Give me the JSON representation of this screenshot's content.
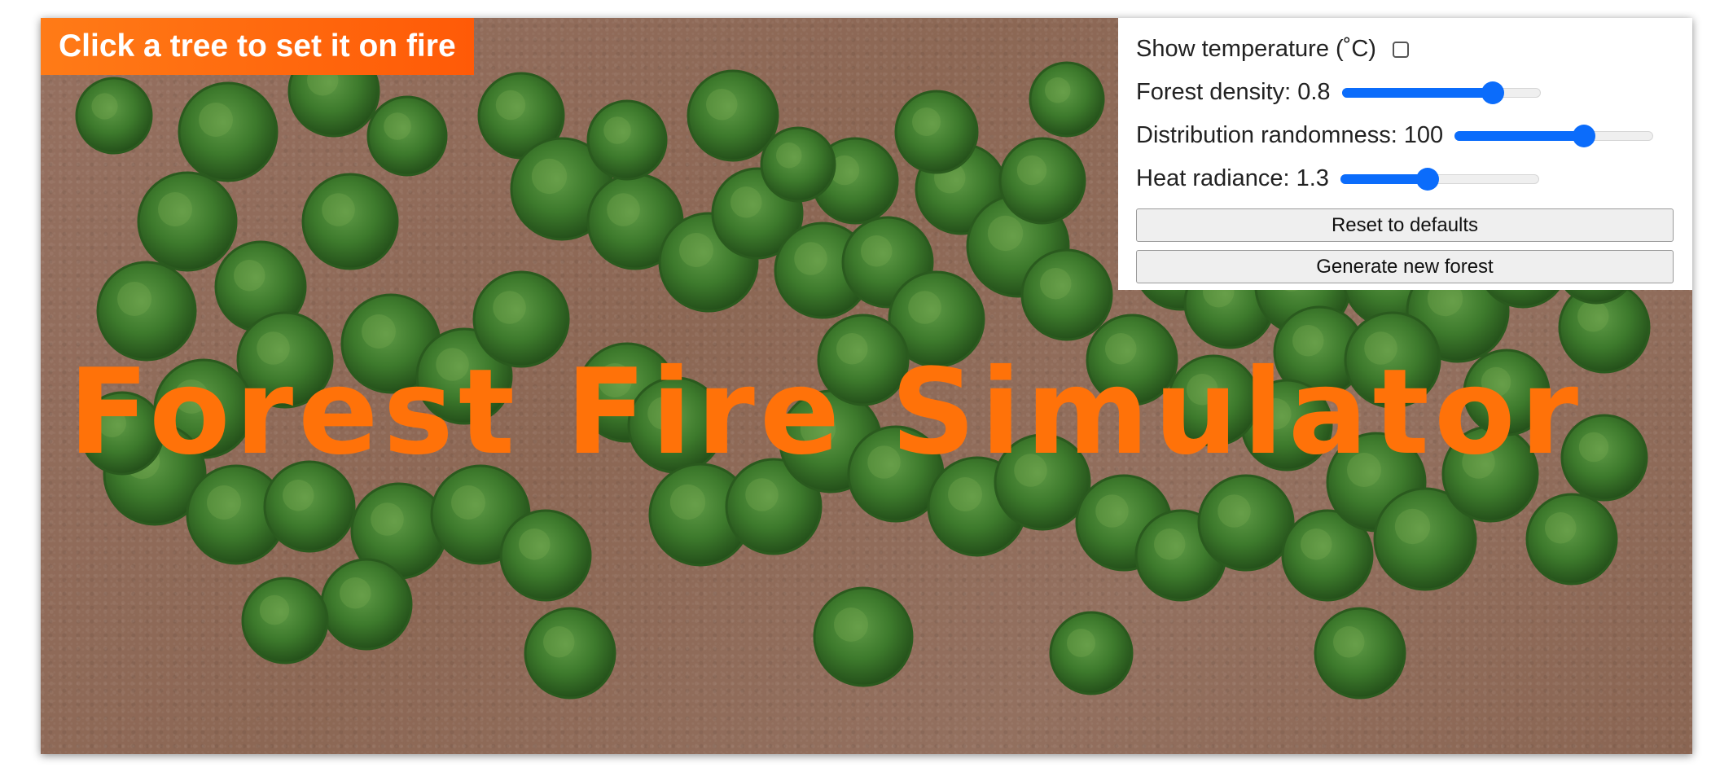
{
  "hint": "Click a tree to set it on fire",
  "title": "Forest Fire Simulator",
  "controls": {
    "show_temperature": {
      "label": "Show temperature (˚C)",
      "checked": false
    },
    "forest_density": {
      "label": "Forest density:",
      "value": "0.8",
      "fraction": 0.76
    },
    "distribution_randomness": {
      "label": "Distribution randomness:",
      "value": "100",
      "fraction": 0.65
    },
    "heat_radiance": {
      "label": "Heat radiance:",
      "value": "1.3",
      "fraction": 0.44
    },
    "reset_button": "Reset to defaults",
    "generate_button": "Generate new forest"
  },
  "colors": {
    "accent": "#ff7209",
    "slider": "#0b6cfb",
    "ground": "#8f6a58",
    "foliage": "#3f7a2e"
  }
}
